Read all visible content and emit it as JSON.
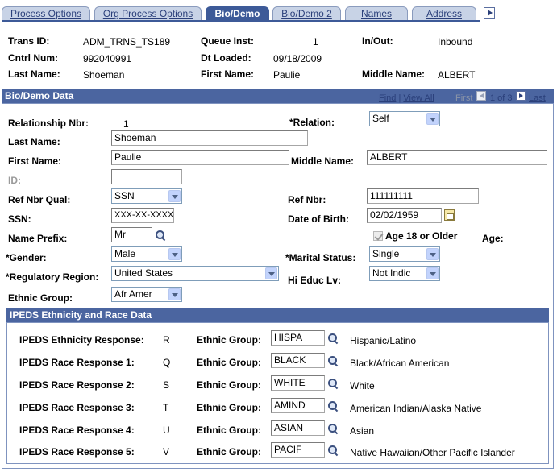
{
  "tabs": [
    {
      "label": "Process Options"
    },
    {
      "label": "Org Process Options"
    },
    {
      "label": "Bio/Demo"
    },
    {
      "label": "Bio/Demo 2"
    },
    {
      "label": "Names"
    },
    {
      "label": "Address"
    }
  ],
  "header": {
    "trans_id_label": "Trans ID:",
    "trans_id": "ADM_TRNS_TS189",
    "queue_inst_label": "Queue Inst:",
    "queue_inst": "1",
    "in_out_label": "In/Out:",
    "in_out": "Inbound",
    "cntrl_num_label": "Cntrl Num:",
    "cntrl_num": "992040991",
    "dt_loaded_label": "Dt Loaded:",
    "dt_loaded": "09/18/2009",
    "last_name_label": "Last Name:",
    "last_name": "Shoeman",
    "first_name_label": "First Name:",
    "first_name": "Paulie",
    "middle_name_label": "Middle Name:",
    "middle_name": "ALBERT"
  },
  "biodemo": {
    "title": "Bio/Demo Data",
    "find": "Find",
    "sep": "|",
    "view_all": "View All",
    "first": "First",
    "counter": "1 of 3",
    "last": "Last",
    "relationship_nbr_label": "Relationship Nbr:",
    "relationship_nbr": "1",
    "relation_label": "*Relation:",
    "relation": "Self",
    "last_name_label": "Last Name:",
    "last_name": "Shoeman",
    "first_name_label": "First Name:",
    "first_name": "Paulie",
    "middle_name_label": "Middle Name:",
    "middle_name": "ALBERT",
    "id_label": "ID:",
    "id": "",
    "ref_nbr_qual_label": "Ref Nbr Qual:",
    "ref_nbr_qual": "SSN",
    "ref_nbr_label": "Ref Nbr:",
    "ref_nbr": "111111111",
    "ssn_label": "SSN:",
    "ssn": "XXX-XX-XXXX",
    "dob_label": "Date of Birth:",
    "dob": "02/02/1959",
    "name_prefix_label": "Name Prefix:",
    "name_prefix": "Mr",
    "age18_label": "Age 18 or Older",
    "age_label": "Age:",
    "gender_label": "*Gender:",
    "gender": "Male",
    "marital_label": "*Marital Status:",
    "marital": "Single",
    "reg_region_label": "*Regulatory Region:",
    "reg_region": "United States",
    "hi_educ_label": "Hi Educ Lv:",
    "hi_educ": "Not Indic",
    "ethnic_group_label": "Ethnic Group:",
    "ethnic_group": "Afr Amer"
  },
  "ipeds": {
    "title": "IPEDS Ethnicity and Race Data",
    "ethnic_group_label": "Ethnic Group:",
    "rows": [
      {
        "label": "IPEDS Ethnicity Response:",
        "code": "R",
        "group": "HISPA",
        "desc": "Hispanic/Latino"
      },
      {
        "label": "IPEDS Race Response 1:",
        "code": "Q",
        "group": "BLACK",
        "desc": "Black/African American"
      },
      {
        "label": "IPEDS Race Response 2:",
        "code": "S",
        "group": "WHITE",
        "desc": "White"
      },
      {
        "label": "IPEDS Race Response 3:",
        "code": "T",
        "group": "AMIND",
        "desc": "American Indian/Alaska Native"
      },
      {
        "label": "IPEDS Race Response 4:",
        "code": "U",
        "group": "ASIAN",
        "desc": "Asian"
      },
      {
        "label": "IPEDS Race Response 5:",
        "code": "V",
        "group": "PACIF",
        "desc": "Native Hawaiian/Other Pacific Islander"
      }
    ]
  }
}
